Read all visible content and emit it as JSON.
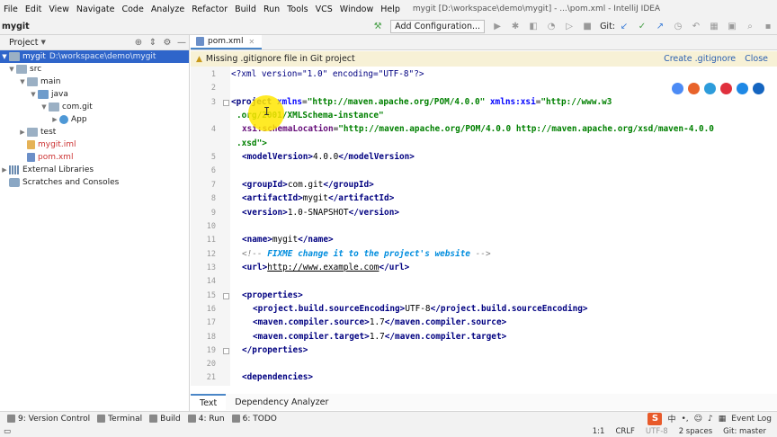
{
  "menu": [
    "File",
    "Edit",
    "View",
    "Navigate",
    "Code",
    "Analyze",
    "Refactor",
    "Build",
    "Run",
    "Tools",
    "VCS",
    "Window",
    "Help"
  ],
  "window_title": "mygit [D:\\workspace\\demo\\mygit] - ...\\pom.xml - IntelliJ IDEA",
  "navbar": {
    "project": "mygit",
    "add_config_label": "Add Configuration...",
    "git_label": "Git:"
  },
  "project_panel": {
    "title": "Project",
    "tree": [
      {
        "label": "mygit",
        "path": "D:\\workspace\\demo\\mygit"
      },
      {
        "label": "src"
      },
      {
        "label": "main"
      },
      {
        "label": "java"
      },
      {
        "label": "com.git"
      },
      {
        "label": "App"
      },
      {
        "label": "test"
      },
      {
        "label": "mygit.iml"
      },
      {
        "label": "pom.xml"
      },
      {
        "label": "External Libraries"
      },
      {
        "label": "Scratches and Consoles"
      }
    ]
  },
  "editor_tab": "pom.xml",
  "banner": {
    "message": "Missing .gitignore file in Git project",
    "create_link": "Create .gitignore",
    "close_link": "Close"
  },
  "code_lines": [
    {
      "n": "1",
      "xml_decl": "<?xml version=\"1.0\" encoding=\"UTF-8\"?>"
    },
    {
      "n": "2"
    },
    {
      "n": "3",
      "a": "<project ",
      "b": "xmlns",
      "c": "=",
      "d": "\"http://maven.apache.org/POM/4.0.0\"",
      "e": " xmlns:xsi",
      "f": "=",
      "g": "\"http://www.w3",
      "cont": ".org/2001/XMLSchema-instance\""
    },
    {
      "n": "4",
      "a": "xsi:schemaLocation",
      "b": "=",
      "c": "\"http://maven.apache.org/POM/4.0.0 http://maven.apache.org/xsd/maven-4.0.0",
      "cont": ".xsd\">"
    },
    {
      "n": "5",
      "open": "<modelVersion>",
      "val": "4.0.0",
      "close": "</modelVersion>"
    },
    {
      "n": "6"
    },
    {
      "n": "7",
      "open": "<groupId>",
      "val": "com.git",
      "close": "</groupId>"
    },
    {
      "n": "8",
      "open": "<artifactId>",
      "val": "mygit",
      "close": "</artifactId>"
    },
    {
      "n": "9",
      "open": "<version>",
      "val": "1.0-SNAPSHOT",
      "close": "</version>"
    },
    {
      "n": "10"
    },
    {
      "n": "11",
      "open": "<name>",
      "val": "mygit",
      "close": "</name>"
    },
    {
      "n": "12",
      "cm_start": "<!-- ",
      "todo": "FIXME change it to the project's website",
      "cm_end": " -->"
    },
    {
      "n": "13",
      "open": "<url>",
      "val": "http://www.example.com",
      "close": "</url>"
    },
    {
      "n": "14"
    },
    {
      "n": "15",
      "open": "<properties>"
    },
    {
      "n": "16",
      "open": "<project.build.sourceEncoding>",
      "val": "UTF-8",
      "close": "</project.build.sourceEncoding>"
    },
    {
      "n": "17",
      "open": "<maven.compiler.source>",
      "val": "1.7",
      "close": "</maven.compiler.source>"
    },
    {
      "n": "18",
      "open": "<maven.compiler.target>",
      "val": "1.7",
      "close": "</maven.compiler.target>"
    },
    {
      "n": "19",
      "open": "</properties>"
    },
    {
      "n": "20"
    },
    {
      "n": "21",
      "open": "<dependencies>"
    }
  ],
  "bottom_tabs": [
    "Text",
    "Dependency Analyzer"
  ],
  "tool_windows": [
    "9: Version Control",
    "Terminal",
    "Build",
    "4: Run",
    "6: TODO"
  ],
  "ime_label": "中",
  "event_log": "Event Log",
  "status": {
    "position": "1:1",
    "line_sep": "CRLF",
    "encoding": "UTF-8",
    "indent": "2 spaces",
    "branch": "Git: master"
  },
  "colors": {
    "selection": "#2f65ca",
    "tag": "#000080",
    "string": "#008000",
    "banner_bg": "#f7f1d6",
    "cursor_highlight": "#ffe600"
  }
}
